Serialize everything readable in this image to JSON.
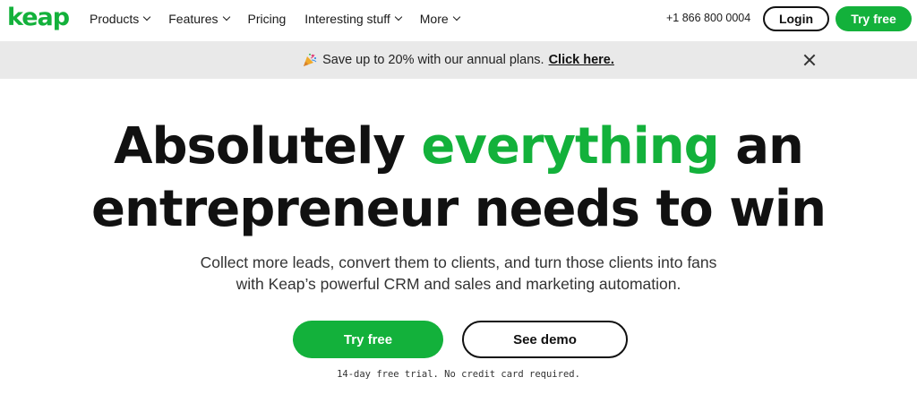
{
  "brand": {
    "logo_text": "keap",
    "accent_color": "#13b13b"
  },
  "nav": {
    "items": [
      {
        "label": "Products",
        "has_dropdown": true
      },
      {
        "label": "Features",
        "has_dropdown": true
      },
      {
        "label": "Pricing",
        "has_dropdown": false
      },
      {
        "label": "Interesting stuff",
        "has_dropdown": true
      },
      {
        "label": "More",
        "has_dropdown": true
      }
    ],
    "phone": "+1 866 800 0004",
    "login_label": "Login",
    "try_free_label": "Try free"
  },
  "banner": {
    "icon": "party-popper-icon",
    "text": "Save up to 20% with our annual plans.",
    "link_text": "Click here.",
    "close_icon": "close-icon"
  },
  "hero": {
    "title_part1": "Absolutely",
    "title_accent": "everything",
    "title_part2": "an",
    "title_line2": "entrepreneur needs to win",
    "subtitle_line1": "Collect more leads, convert them to clients, and turn those clients into fans",
    "subtitle_line2": "with Keap’s powerful CRM and sales and marketing automation.",
    "primary_cta": "Try free",
    "secondary_cta": "See demo",
    "note": "14-day free trial. No credit card required."
  }
}
